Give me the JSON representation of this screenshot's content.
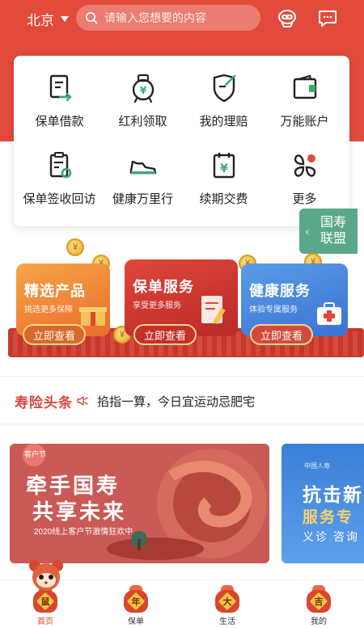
{
  "header": {
    "city": "北京",
    "search_placeholder": "请输入您想要的内容",
    "icons": [
      "robot-service-icon",
      "message-icon"
    ]
  },
  "services": [
    {
      "label": "保单借款",
      "icon": "loan-document-icon"
    },
    {
      "label": "红利领取",
      "icon": "piggy-bank-icon"
    },
    {
      "label": "我的理赔",
      "icon": "claim-shield-icon"
    },
    {
      "label": "万能账户",
      "icon": "wallet-icon"
    },
    {
      "label": "保单签收回访",
      "icon": "clipboard-sign-icon"
    },
    {
      "label": "健康万里行",
      "icon": "sneaker-icon"
    },
    {
      "label": "续期交费",
      "icon": "calendar-payment-icon"
    },
    {
      "label": "更多",
      "icon": "more-grid-icon"
    }
  ],
  "alliance": {
    "line1": "国寿",
    "line2": "联盟",
    "icon": "chevron-left-icon"
  },
  "promo": {
    "panels": [
      {
        "title": "精选产品",
        "subtitle": "挑选更多保障",
        "button": "立即查看"
      },
      {
        "title": "保单服务",
        "subtitle": "享受更多服务",
        "button": "立即查看"
      },
      {
        "title": "健康服务",
        "subtitle": "体验专属服务",
        "button": "立即查看"
      }
    ],
    "coin_symbol": "¥"
  },
  "headlines": {
    "title": "寿险头条",
    "text": "掐指一算，今日宜运动忌肥宅",
    "icon": "speaker-icon"
  },
  "activity": {
    "card1": {
      "line1": "牵手国寿",
      "line2": "共享未来",
      "caption": "2020线上客户节激情狂欢中",
      "badge": "客户节"
    },
    "card2": {
      "logo": "中国人寿",
      "line1": "抗击新",
      "line2": "服务专",
      "line3": "义诊 咨询 自"
    }
  },
  "tabbar": {
    "tabs": [
      {
        "label": "首页",
        "char": "鼠",
        "active": true
      },
      {
        "label": "保单",
        "char": "年"
      },
      {
        "label": "生活",
        "char": "大"
      },
      {
        "label": "我的",
        "char": "吉"
      }
    ]
  },
  "colors": {
    "brand_red": "#e24a3c",
    "alliance_green": "#5aa88a",
    "coin_gold": "#e6a92a"
  }
}
